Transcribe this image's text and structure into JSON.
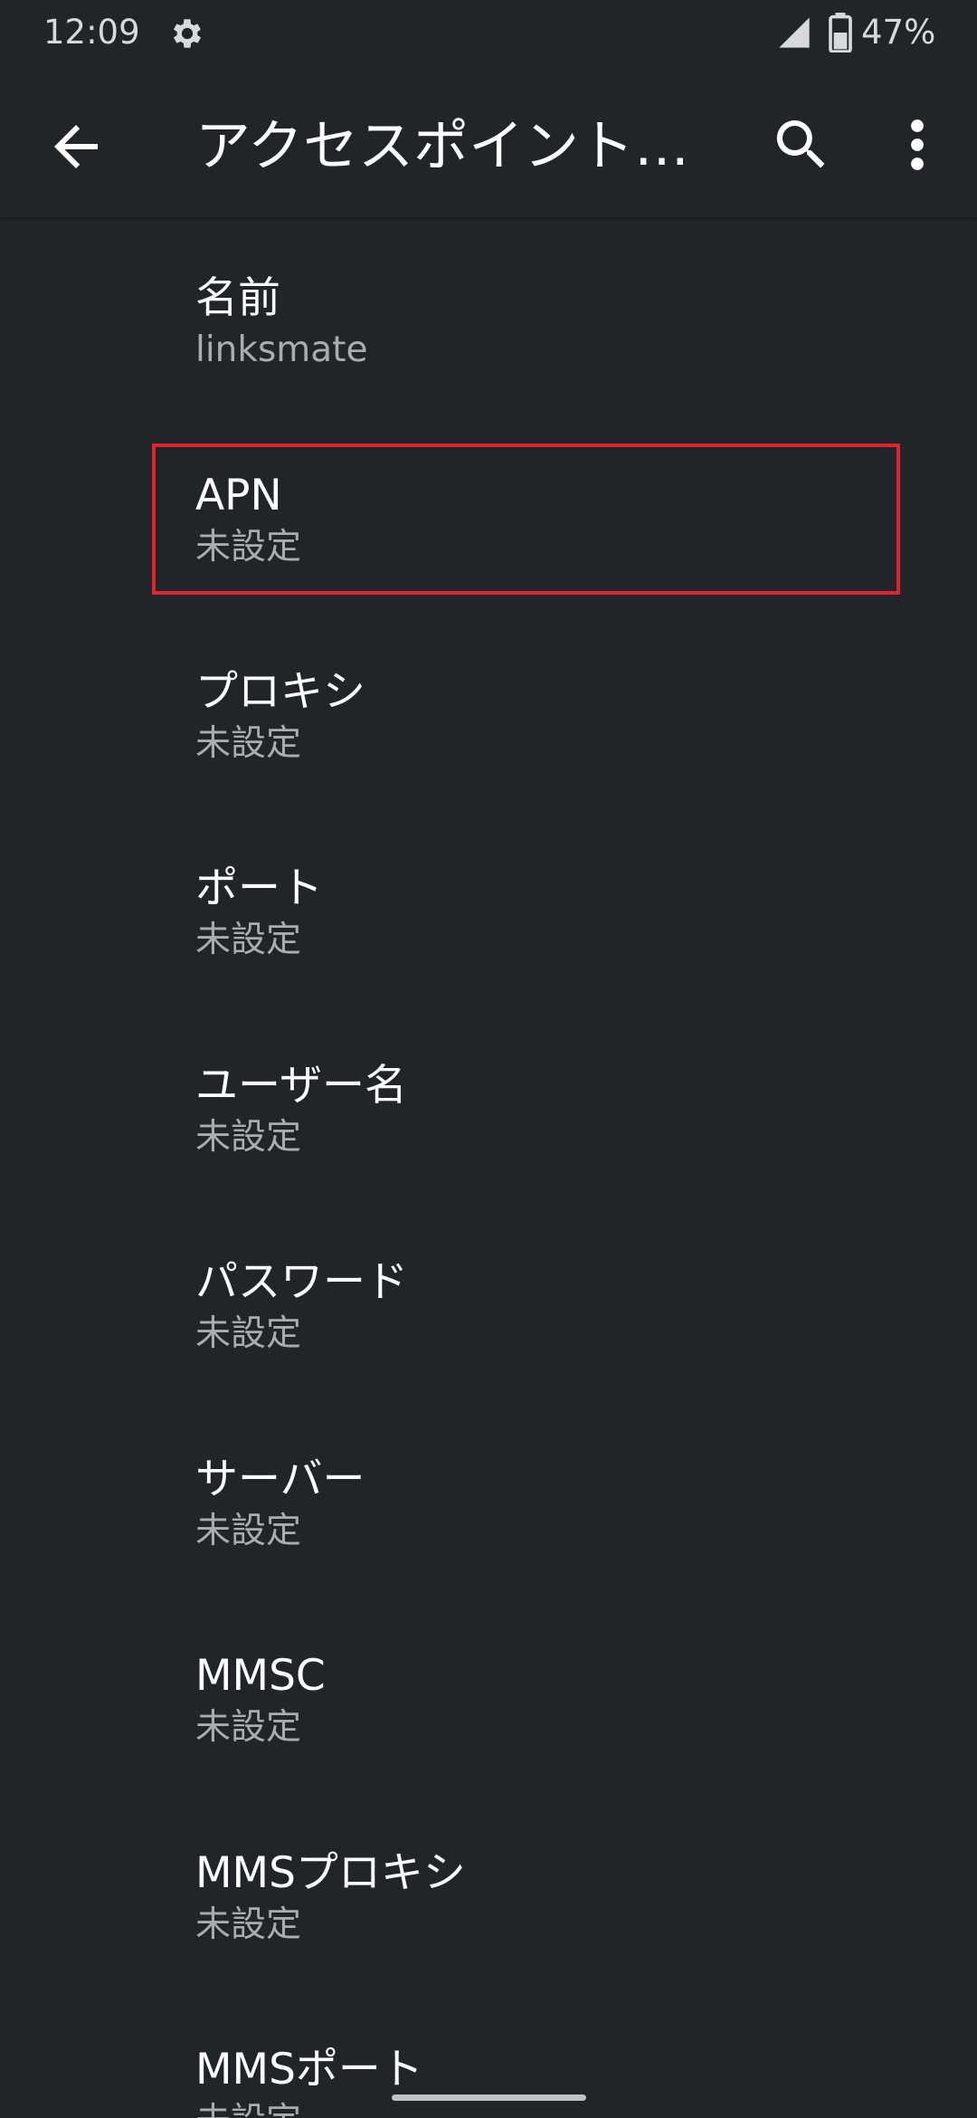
{
  "status_bar": {
    "time": "12:09",
    "battery_percent": "47%",
    "icons": [
      "gear-icon",
      "cell-signal-icon",
      "battery-icon"
    ]
  },
  "app_bar": {
    "title": "アクセスポイント…",
    "icons": [
      "back-arrow-icon",
      "search-icon",
      "more-vert-icon"
    ]
  },
  "items": [
    {
      "title": "名前",
      "summary": "linksmate"
    },
    {
      "title": "APN",
      "summary": "未設定"
    },
    {
      "title": "プロキシ",
      "summary": "未設定"
    },
    {
      "title": "ポート",
      "summary": "未設定"
    },
    {
      "title": "ユーザー名",
      "summary": "未設定"
    },
    {
      "title": "パスワード",
      "summary": "未設定"
    },
    {
      "title": "サーバー",
      "summary": "未設定"
    },
    {
      "title": "MMSC",
      "summary": "未設定"
    },
    {
      "title": "MMSプロキシ",
      "summary": "未設定"
    },
    {
      "title": "MMSポート",
      "summary": "未設定"
    }
  ],
  "colors": {
    "background": "#212529",
    "primary_text": "#ffffff",
    "secondary_text": "#a9adb1",
    "highlight": "#e0242b"
  }
}
